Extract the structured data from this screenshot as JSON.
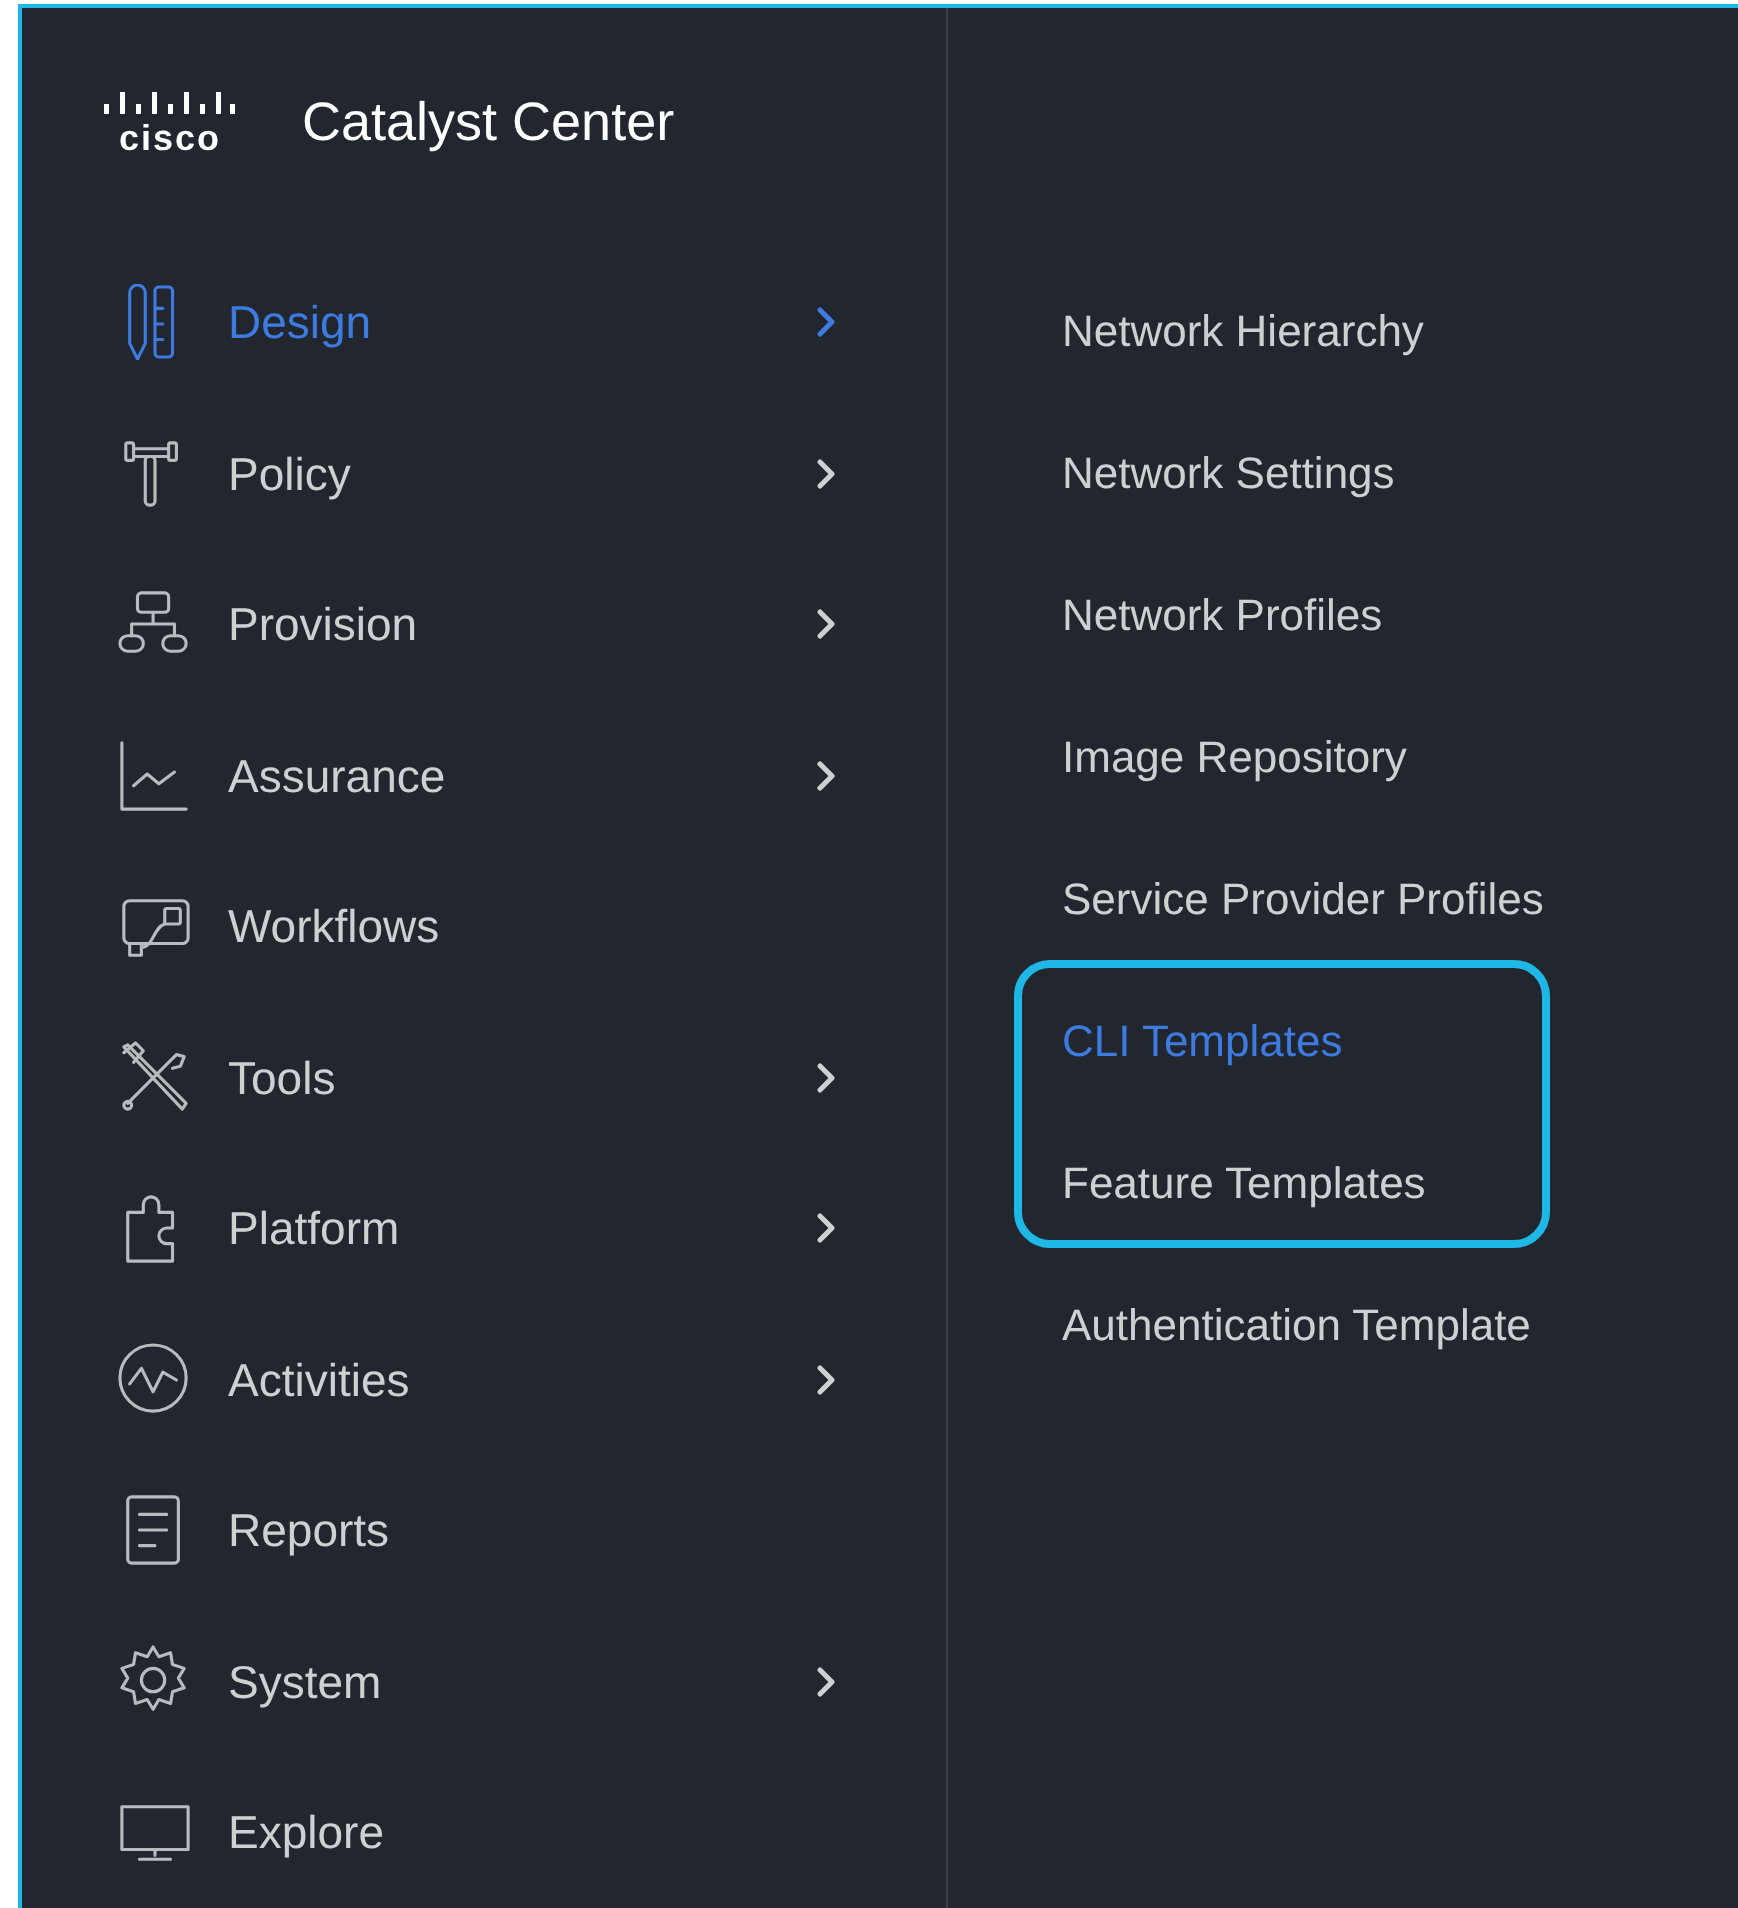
{
  "header": {
    "logo_text": "cisco",
    "title": "Catalyst Center"
  },
  "menu": [
    {
      "label": "Design",
      "selected": true,
      "has_submenu": true
    },
    {
      "label": "Policy",
      "selected": false,
      "has_submenu": true
    },
    {
      "label": "Provision",
      "selected": false,
      "has_submenu": true
    },
    {
      "label": "Assurance",
      "selected": false,
      "has_submenu": true
    },
    {
      "label": "Workflows",
      "selected": false,
      "has_submenu": false
    },
    {
      "label": "Tools",
      "selected": false,
      "has_submenu": true
    },
    {
      "label": "Platform",
      "selected": false,
      "has_submenu": true
    },
    {
      "label": "Activities",
      "selected": false,
      "has_submenu": true
    },
    {
      "label": "Reports",
      "selected": false,
      "has_submenu": false
    },
    {
      "label": "System",
      "selected": false,
      "has_submenu": true
    },
    {
      "label": "Explore",
      "selected": false,
      "has_submenu": false
    }
  ],
  "submenu": [
    {
      "label": "Network Hierarchy",
      "selected": false,
      "highlighted": false
    },
    {
      "label": "Network Settings",
      "selected": false,
      "highlighted": false
    },
    {
      "label": "Network Profiles",
      "selected": false,
      "highlighted": false
    },
    {
      "label": "Image Repository",
      "selected": false,
      "highlighted": false
    },
    {
      "label": "Service Provider Profiles",
      "selected": false,
      "highlighted": false
    },
    {
      "label": "CLI Templates",
      "selected": true,
      "highlighted": true
    },
    {
      "label": "Feature Templates",
      "selected": false,
      "highlighted": true
    },
    {
      "label": "Authentication Template",
      "selected": false,
      "highlighted": false
    }
  ]
}
